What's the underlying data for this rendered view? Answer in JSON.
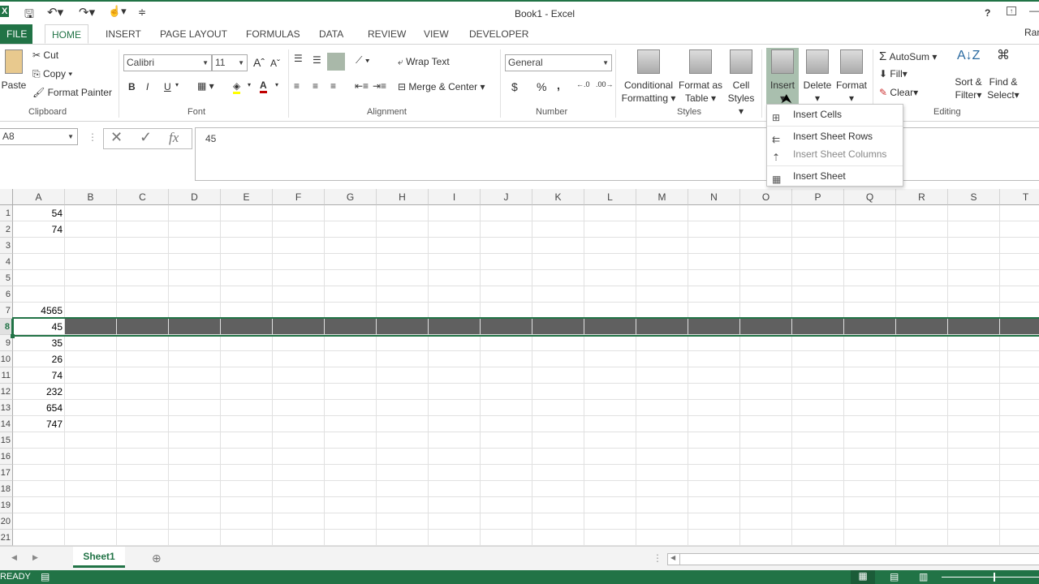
{
  "window": {
    "title": "Book1 - Excel",
    "user": "Ran",
    "help": "?"
  },
  "tabs": [
    "FILE",
    "HOME",
    "INSERT",
    "PAGE LAYOUT",
    "FORMULAS",
    "DATA",
    "REVIEW",
    "VIEW",
    "DEVELOPER"
  ],
  "clipboard": {
    "paste": "Paste",
    "cut": "Cut",
    "copy": "Copy",
    "format_painter": "Format Painter",
    "label": "Clipboard"
  },
  "font": {
    "name": "Calibri",
    "size": "11",
    "bold": "B",
    "italic": "I",
    "underline": "U",
    "label": "Font"
  },
  "alignment": {
    "wrap": "Wrap Text",
    "merge": "Merge & Center",
    "label": "Alignment"
  },
  "number": {
    "format": "General",
    "currency": "$",
    "percent": "%",
    "comma": ",",
    "label": "Number"
  },
  "styles": {
    "conditional": "Conditional",
    "conditional2": "Formatting",
    "format_table": "Format as",
    "format_table2": "Table",
    "cell_styles": "Cell",
    "cell_styles2": "Styles",
    "label": "Styles"
  },
  "cells": {
    "insert": "Insert",
    "delete": "Delete",
    "format": "Format"
  },
  "editing": {
    "autosum": "AutoSum",
    "fill": "Fill",
    "clear": "Clear",
    "sort": "Sort &",
    "sort2": "Filter",
    "find": "Find &",
    "find2": "Select",
    "label": "Editing"
  },
  "insert_menu": [
    "Insert Cells",
    "Insert Sheet Rows",
    "Insert Sheet Columns",
    "Insert Sheet"
  ],
  "formula_bar": {
    "name_box": "A8",
    "value": "45",
    "fx": "fx"
  },
  "columns": [
    "A",
    "B",
    "C",
    "D",
    "E",
    "F",
    "G",
    "H",
    "I",
    "J",
    "K",
    "L",
    "M",
    "N",
    "O",
    "P",
    "Q",
    "R",
    "S",
    "T"
  ],
  "rows": [
    "1",
    "2",
    "3",
    "4",
    "5",
    "6",
    "7",
    "8",
    "9",
    "10",
    "11",
    "12",
    "13",
    "14",
    "15",
    "16",
    "17",
    "18",
    "19",
    "20",
    "21"
  ],
  "column_a": [
    "54",
    "74",
    "",
    "",
    "",
    "",
    "4565",
    "45",
    "35",
    "26",
    "74",
    "232",
    "654",
    "747",
    "",
    "",
    "",
    "",
    "",
    "",
    ""
  ],
  "selected_row": 8,
  "sheets": [
    "Sheet1"
  ],
  "status": {
    "text": "READY"
  },
  "colors": {
    "accent": "#217346",
    "selected_row": "#606060"
  }
}
